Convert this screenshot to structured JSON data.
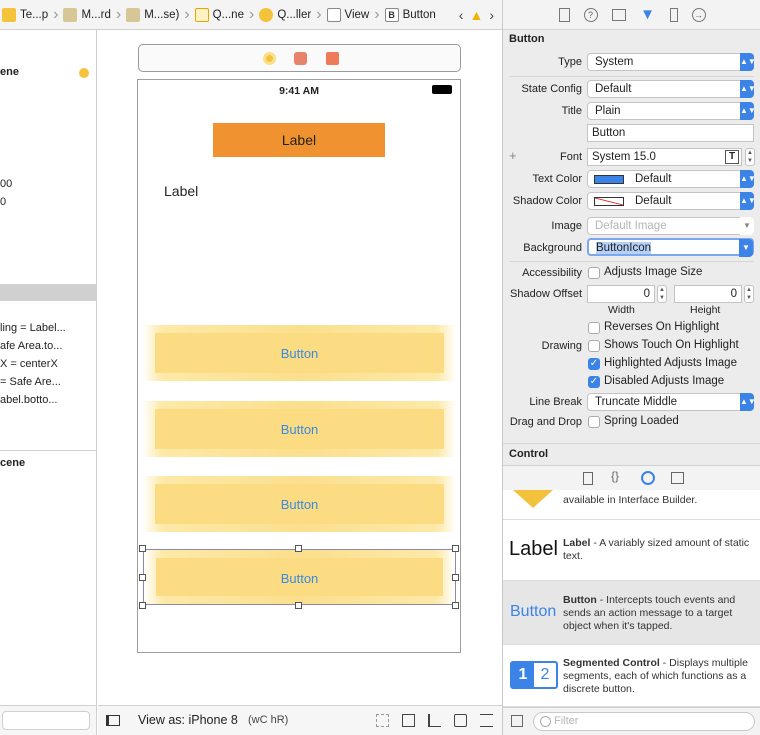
{
  "jumpbar": {
    "crumbs": [
      "Te...p",
      "M...rd",
      "M...se)",
      "Q...ne",
      "Q...ller",
      "View",
      "Button"
    ]
  },
  "outline": {
    "scene1": "ene",
    "val1": "00",
    "val2": "0",
    "constraints": [
      "ling = Label...",
      "afe Area.to...",
      "X = centerX",
      "= Safe Are...",
      "abel.botto..."
    ],
    "scene2": "cene"
  },
  "canvas": {
    "status_time": "9:41 AM",
    "orange_label": "Label",
    "plain_label": "Label",
    "buttons": [
      "Button",
      "Button",
      "Button",
      "Button"
    ],
    "bottom": {
      "view_as": "View as: iPhone 8",
      "size_class": "(wC hR)"
    }
  },
  "inspector": {
    "section_button": "Button",
    "type_label": "Type",
    "type_value": "System",
    "state_label": "State Config",
    "state_value": "Default",
    "title_label": "Title",
    "title_value": "Plain",
    "title_text": "Button",
    "font_label": "Font",
    "font_value": "System 15.0",
    "text_color_label": "Text Color",
    "text_color_value": "Default",
    "shadow_color_label": "Shadow Color",
    "shadow_color_value": "Default",
    "image_label": "Image",
    "image_placeholder": "Default Image",
    "background_label": "Background",
    "background_value": "ButtonIcon",
    "accessibility_label": "Accessibility",
    "adjusts_image_size": "Adjusts Image Size",
    "shadow_offset_label": "Shadow Offset",
    "shadow_w": "0",
    "shadow_h": "0",
    "width_label": "Width",
    "height_label": "Height",
    "reverses": "Reverses On Highlight",
    "drawing_label": "Drawing",
    "shows_touch": "Shows Touch On Highlight",
    "highlighted_adjusts": "Highlighted Adjusts Image",
    "disabled_adjusts": "Disabled Adjusts Image",
    "line_break_label": "Line Break",
    "line_break_value": "Truncate Middle",
    "drag_drop_label": "Drag and Drop",
    "spring_loaded": "Spring Loaded",
    "section_control": "Control"
  },
  "library": {
    "partial_desc": "available in Interface Builder.",
    "items": [
      {
        "icon": "Label",
        "title": "Label",
        "desc": " - A variably sized amount of static text."
      },
      {
        "icon": "Button",
        "title": "Button",
        "desc": " - Intercepts touch events and sends an action message to a target object when it's tapped."
      },
      {
        "icon": "1 2",
        "title": "Segmented Control",
        "desc": " - Displays multiple segments, each of which functions as a discrete button."
      }
    ],
    "filter_placeholder": "Filter"
  },
  "colors": {
    "accent": "#3c83e8",
    "orange_label": "#f0922f",
    "button_text": "#3b8ae0",
    "button_bg": "#fbdc83"
  }
}
